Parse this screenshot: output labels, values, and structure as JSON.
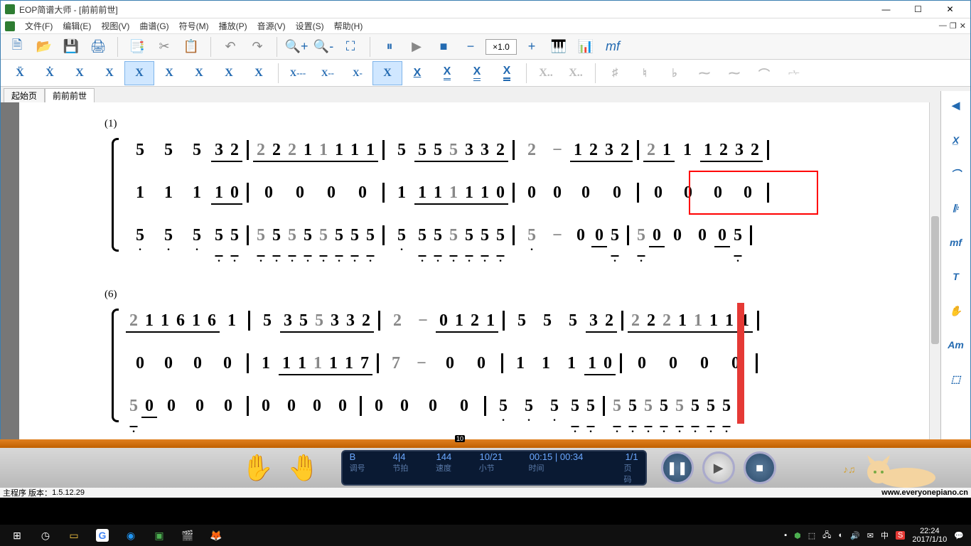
{
  "title": "EOP简谱大师 - [前前前世]",
  "menu": [
    "文件(F)",
    "编辑(E)",
    "视图(V)",
    "曲谱(G)",
    "符号(M)",
    "播放(P)",
    "音源(V)",
    "设置(S)",
    "帮助(H)"
  ],
  "zoom": "×1.0",
  "tabs": {
    "start": "起始页",
    "doc": "前前前世"
  },
  "right_panel": [
    "◄",
    "X̲",
    "⌒",
    "𝄆",
    "mf",
    "T",
    "✋",
    "Am",
    "⬚"
  ],
  "note_toolbar": {
    "group1": [
      "Ẍ",
      "Ẋ",
      "X̌",
      "X́",
      "X",
      "X̣",
      "Ẍ̣",
      "X̣̌",
      "X̣́"
    ],
    "group2": [
      "X---",
      "X--",
      "X-",
      "X",
      "X̲",
      "X̲̲",
      "X̲̲̲",
      "X̲̲̲̲"
    ],
    "group3": [
      "X..",
      "X.."
    ],
    "group4": [
      "♯",
      "♮",
      "♭",
      "⁓",
      "⁓",
      "⌒",
      "⌐³⌐"
    ]
  },
  "score": {
    "system1_label": "(1)",
    "system2_label": "(6)"
  },
  "player": {
    "key": "B",
    "time_sig": "4|4",
    "tempo": "144",
    "measure": "10/21",
    "time": "00:15  |   00:34",
    "page": "1/1",
    "labels": {
      "key": "调号",
      "time_sig": "节拍",
      "tempo": "速度",
      "measure": "小节",
      "time": "时间",
      "page": "页码"
    }
  },
  "status": {
    "version_label": "主程序 版本：",
    "version": "1.5.12.29",
    "url": "www.everyonepiano.cn"
  },
  "taskbar": {
    "time": "22:24",
    "date": "2017/1/10",
    "ime": "中"
  }
}
